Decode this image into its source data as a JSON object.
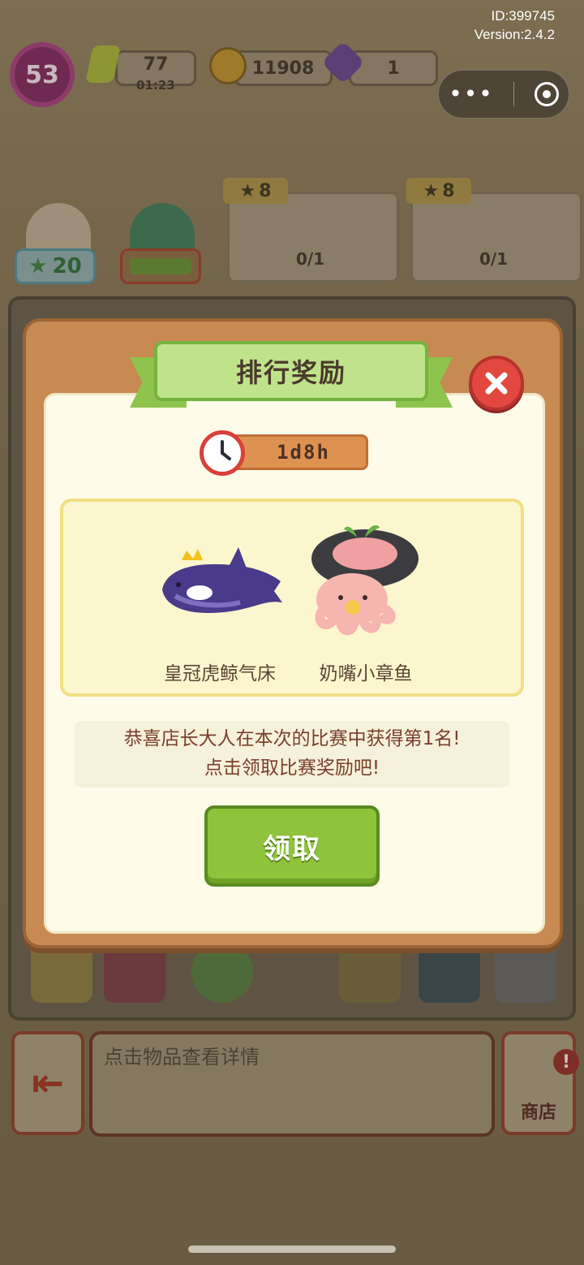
{
  "top_info": {
    "id_text": "ID:399745",
    "version_text": "Version:2.4.2"
  },
  "hud": {
    "level": "53",
    "energy": "77",
    "energy_timer": "01:23",
    "coins": "11908",
    "gems": "1"
  },
  "npcs": {
    "badge_value": "20"
  },
  "orders": [
    {
      "stars": "8",
      "progress": "0/1"
    },
    {
      "stars": "8",
      "progress": "0/1"
    }
  ],
  "modal": {
    "title": "排行奖励",
    "timer": "1d8h",
    "rewards": [
      {
        "name": "皇冠虎鲸气床",
        "icon": "crowned-orca-float-icon"
      },
      {
        "name": "奶嘴小章鱼",
        "icon": "pacifier-octopus-icon"
      }
    ],
    "message_line1": "恭喜店长大人在本次的比赛中获得第1名!",
    "message_line2": "点击领取比赛奖励吧!",
    "claim_label": "领取"
  },
  "bottom": {
    "detail_placeholder": "点击物品查看详情",
    "shop_label": "商店",
    "shop_alert": "!"
  },
  "colors": {
    "modal_frame": "#c78a52",
    "ribbon": "#bfe38a",
    "claim_button": "#8ec33b",
    "close_button": "#e2483f",
    "timer_pill": "#de9252"
  }
}
